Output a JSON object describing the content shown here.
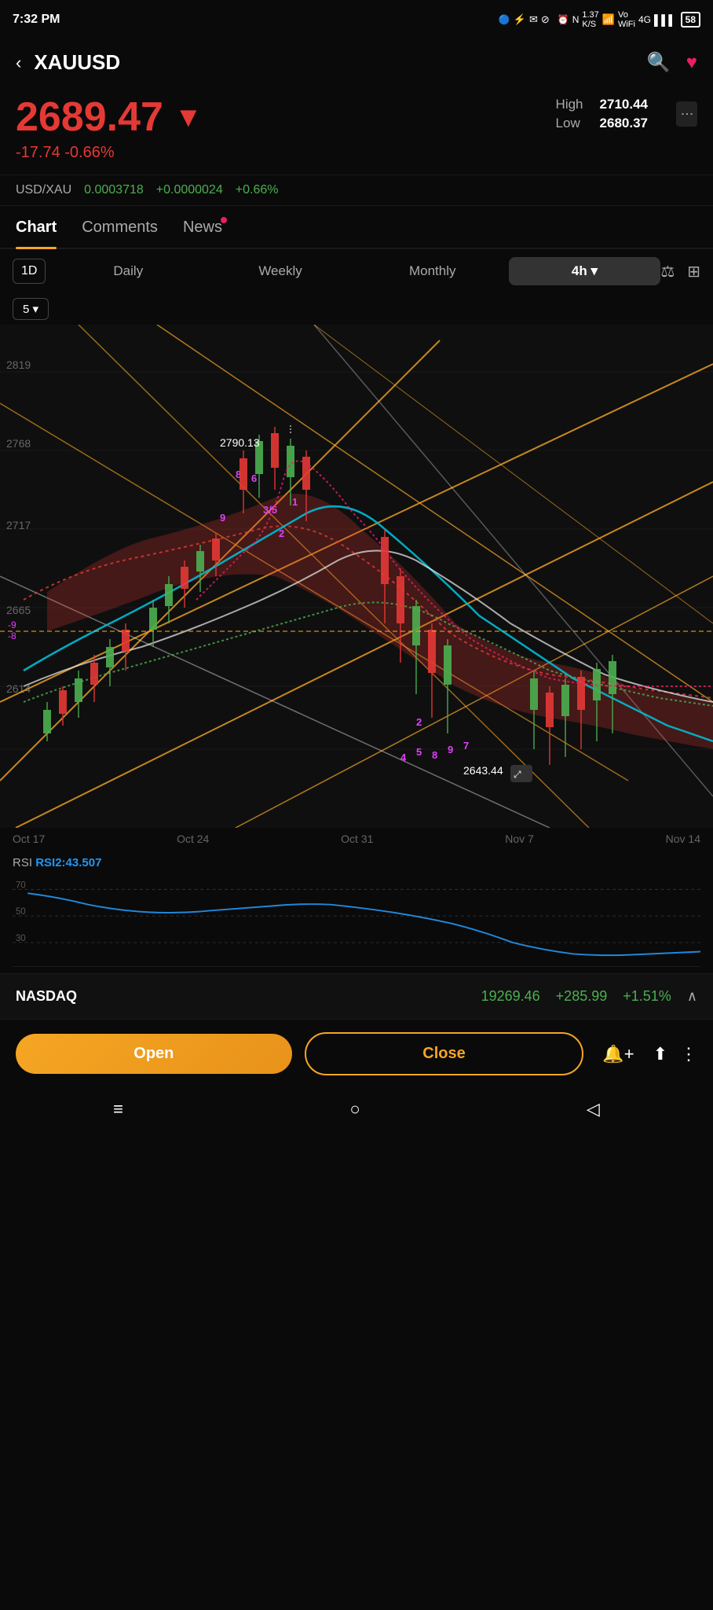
{
  "statusBar": {
    "time": "7:32 PM",
    "battery": "58"
  },
  "header": {
    "symbol": "XAUUSD",
    "backLabel": "‹",
    "searchIcon": "🔍",
    "heartIcon": "♥"
  },
  "price": {
    "value": "2689.47",
    "arrow": "▼",
    "change": "-17.74 -0.66%",
    "high_label": "High",
    "low_label": "Low",
    "high_value": "2710.44",
    "low_value": "2680.37"
  },
  "usdXau": {
    "label": "USD/XAU",
    "value": "0.0003718",
    "change": "+0.0000024",
    "pct": "+0.66%"
  },
  "tabs": [
    {
      "label": "Chart",
      "active": true,
      "dot": false
    },
    {
      "label": "Comments",
      "active": false,
      "dot": false
    },
    {
      "label": "News",
      "active": false,
      "dot": true
    }
  ],
  "timeframes": {
    "boxLabel": "1D",
    "items": [
      "Daily",
      "Weekly",
      "Monthly"
    ],
    "active": "4h",
    "activeLabel": "4h ▾"
  },
  "zoomLevel": "5 ▾",
  "chart": {
    "yLabels": [
      "2819",
      "2768",
      "2717",
      "2665",
      "2614"
    ],
    "annotations": [
      "2790.13",
      "2643.44"
    ],
    "xLabels": [
      "Oct 17",
      "Oct 24",
      "Oct 31",
      "Nov 7",
      "Nov 14"
    ]
  },
  "rsi": {
    "label": "RSI",
    "value": "RSI2:43.507",
    "levels": [
      "70",
      "50",
      "30"
    ]
  },
  "nasdaq": {
    "label": "NASDAQ",
    "price": "19269.46",
    "change": "+285.99",
    "pct": "+1.51%",
    "arrow": "∧"
  },
  "actions": {
    "openLabel": "Open",
    "closeLabel": "Close"
  },
  "sysNav": {
    "menu": "≡",
    "home": "○",
    "back": "◁"
  }
}
